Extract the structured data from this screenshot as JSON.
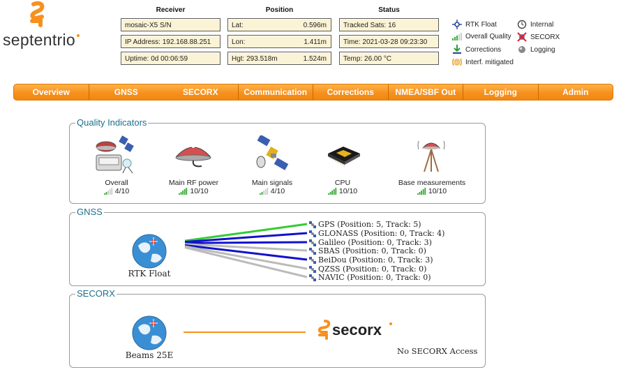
{
  "logo": {
    "text": "septentrio"
  },
  "columns": {
    "receiver": "Receiver",
    "position": "Position",
    "status": "Status"
  },
  "receiver": {
    "model": "mosaic-X5 S/N",
    "ip": "IP Address: 192.168.88.251",
    "uptime": "Uptime: 0d 00:06:59"
  },
  "position": {
    "lat_label": "Lat:",
    "lat_value": "0.596m",
    "lon_label": "Lon:",
    "lon_value": "1.411m",
    "hgt_label": "Hgt: 293.518m",
    "hgt_value": "1.524m"
  },
  "status": {
    "sats": "Tracked Sats: 16",
    "time": "Time: 2021-03-28 09:23:30",
    "temp": "Temp: 26.00 °C"
  },
  "legend": {
    "rtk_float": "RTK Float",
    "internal": "Internal",
    "overall_quality": "Overall Quality",
    "secorx": "SECORX",
    "corrections": "Corrections",
    "logging": "Logging",
    "interf": "Interf. mitigated"
  },
  "nav": [
    "Overview",
    "GNSS",
    "SECORX",
    "Communication",
    "Corrections",
    "NMEA/SBF Out",
    "Logging",
    "Admin"
  ],
  "quality": {
    "title": "Quality Indicators",
    "items": [
      {
        "label": "Overall",
        "value": "4/10",
        "level": 4
      },
      {
        "label": "Main RF power",
        "value": "10/10",
        "level": 10
      },
      {
        "label": "Main signals",
        "value": "4/10",
        "level": 4
      },
      {
        "label": "CPU",
        "value": "10/10",
        "level": 10
      },
      {
        "label": "Base measurements",
        "value": "10/10",
        "level": 10
      }
    ]
  },
  "gnss": {
    "title": "GNSS",
    "mode": "RTK Float",
    "systems": [
      {
        "text": "GPS (Position: 5, Track: 5)",
        "color": "#33cc33"
      },
      {
        "text": "GLONASS (Position: 0, Track: 4)",
        "color": "#1111cc"
      },
      {
        "text": "Galileo (Position: 0, Track: 3)",
        "color": "#1111cc"
      },
      {
        "text": "SBAS (Position: 0, Track: 0)",
        "color": "#bbbbbb"
      },
      {
        "text": "BeiDou (Position: 0, Track: 3)",
        "color": "#1111cc"
      },
      {
        "text": "QZSS (Position: 0, Track: 0)",
        "color": "#bbbbbb"
      },
      {
        "text": "NAVIC (Position: 0, Track: 0)",
        "color": "#bbbbbb"
      }
    ]
  },
  "secorx": {
    "title": "SECORX",
    "beam": "Beams 25E",
    "logo_text": "secorx",
    "status": "No SECORX Access"
  },
  "colors": {
    "accent": "#f7901e",
    "panel_title": "#1d6f8c",
    "field_bg": "#fbf3d5"
  }
}
